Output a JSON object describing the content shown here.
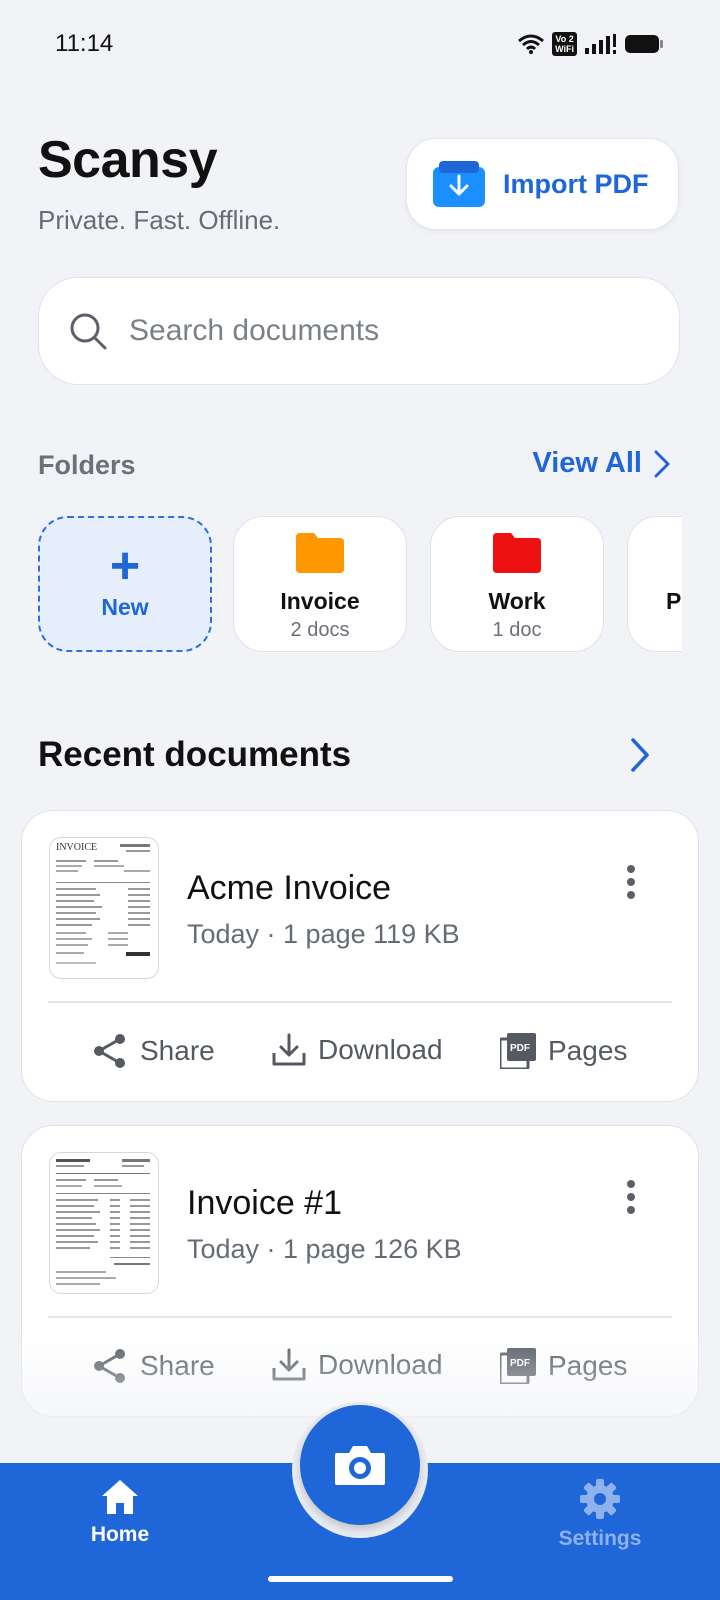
{
  "status_bar": {
    "time": "11:14",
    "vowifi_top": "Vo 2",
    "vowifi_bottom": "WiFi"
  },
  "header": {
    "title": "Scansy",
    "subtitle": "Private. Fast. Offline.",
    "import_label": "Import PDF"
  },
  "search": {
    "placeholder": "Search documents"
  },
  "folders": {
    "section_label": "Folders",
    "view_all": "View All",
    "new_label": "New",
    "items": [
      {
        "name": "Invoice",
        "count": "2 docs",
        "color": "#ff9800"
      },
      {
        "name": "Work",
        "count": "1 doc",
        "color": "#ee1111"
      },
      {
        "name": "P",
        "count": "",
        "color": "#7a5cff"
      }
    ]
  },
  "recent": {
    "title": "Recent documents",
    "documents": [
      {
        "name": "Acme Invoice",
        "meta": "Today · 1 page  119 KB"
      },
      {
        "name": "Invoice #1",
        "meta": "Today · 1 page  126 KB"
      }
    ],
    "actions": {
      "share": "Share",
      "download": "Download",
      "pages": "Pages"
    }
  },
  "bottom_nav": {
    "home": "Home",
    "settings": "Settings"
  },
  "colors": {
    "accent": "#1f66d8",
    "background": "#f1f3f6"
  }
}
